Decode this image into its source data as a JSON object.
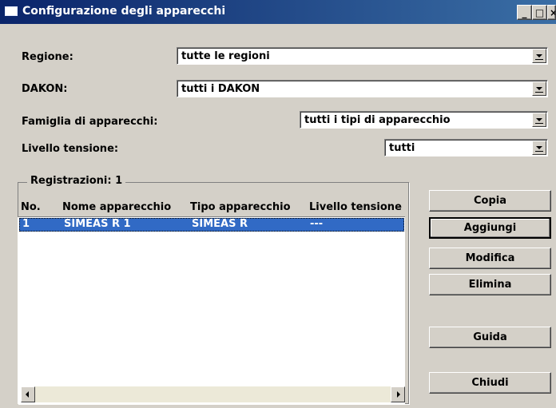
{
  "window": {
    "title": "Configurazione degli apparecchi",
    "minimize_glyph": "_",
    "maximize_glyph": "□",
    "close_glyph": "×"
  },
  "filters": {
    "region": {
      "label": "Regione:",
      "value": "tutte le regioni"
    },
    "dakon": {
      "label": "DAKON:",
      "value": "tutti i DAKON"
    },
    "family": {
      "label": "Famiglia di apparecchi:",
      "value": "tutti i tipi di apparecchio"
    },
    "voltage": {
      "label": "Livello tensione:",
      "value": "tutti"
    }
  },
  "list": {
    "group_title": "Registrazioni: 1",
    "columns": [
      "No.",
      "Nome apparecchio",
      "Tipo apparecchio",
      "Livello tensione"
    ],
    "rows": [
      {
        "no": "1",
        "name": "SIMEAS R 1",
        "type": "SIMEAS R",
        "voltage": "---",
        "selected": true
      }
    ]
  },
  "buttons": {
    "copy": "Copia",
    "add": "Aggiungi",
    "edit": "Modifica",
    "delete": "Elimina",
    "help": "Guida",
    "close": "Chiudi"
  },
  "colors": {
    "title_bar_start": "#0a246a",
    "title_bar_end": "#3a6ea5",
    "selection": "#316ac5",
    "face": "#d4d0c8"
  }
}
